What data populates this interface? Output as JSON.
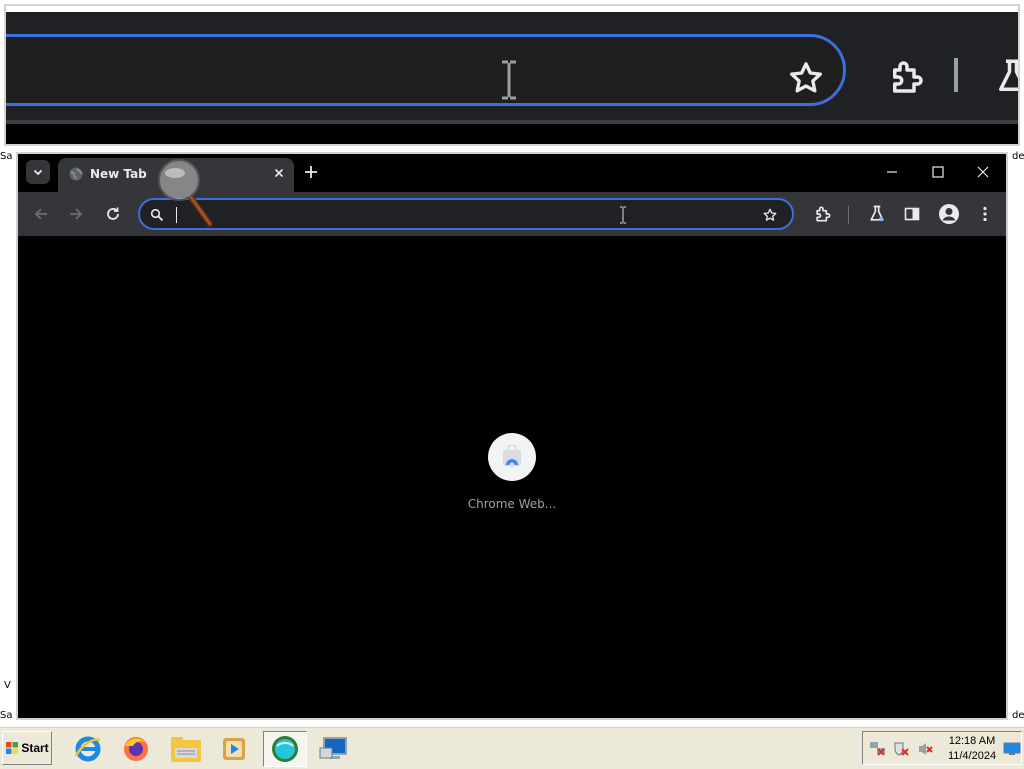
{
  "desktop": {
    "left_top_text": "Sa",
    "right_top_text": "de",
    "left_mid_text": "V",
    "left_bottom_text": "Sa",
    "right_bottom_text": "de"
  },
  "browser": {
    "tabs": [
      {
        "title": "New Tab",
        "favicon": "globe-icon"
      }
    ],
    "omnibox": {
      "value": "",
      "placeholder": ""
    },
    "toolbar_icons": [
      "back-arrow-icon",
      "forward-arrow-icon",
      "reload-icon",
      "search-icon",
      "bookmark-star-icon",
      "extensions-puzzle-icon",
      "labs-flask-icon",
      "side-panel-icon",
      "profile-avatar-icon",
      "more-menu-icon"
    ],
    "shortcuts": [
      {
        "label": "Chrome Web...",
        "icon": "chrome-web-store-icon"
      }
    ],
    "colors": {
      "accent": "#3b6fd9",
      "toolbar": "#35363a",
      "background": "#000000"
    }
  },
  "taskbar": {
    "start_label": "Start",
    "apps": [
      "internet-explorer-icon",
      "firefox-icon",
      "file-manager-icon",
      "media-player-icon",
      "chat-app-icon",
      "remote-desktop-icon"
    ],
    "active_app": "chat-app-icon",
    "clock_time": "12:18 AM",
    "clock_date": "11/4/2024"
  }
}
